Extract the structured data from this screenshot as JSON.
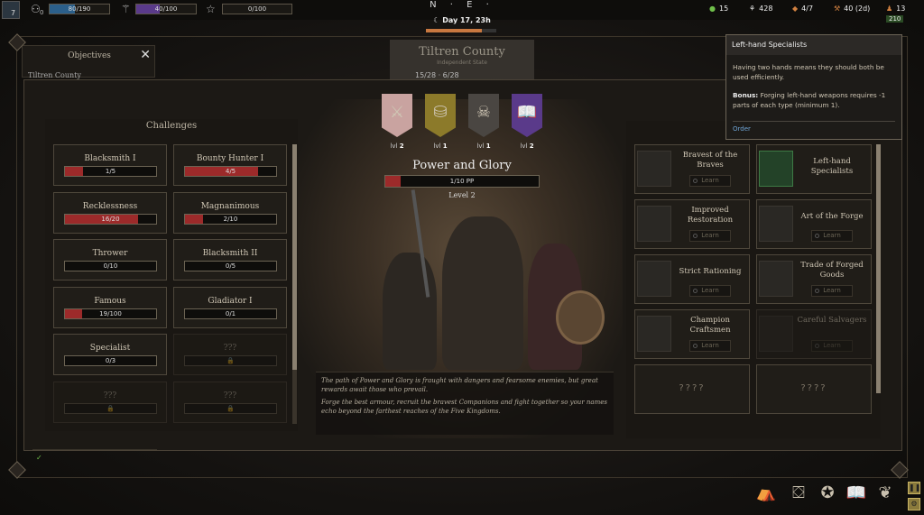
{
  "topbar": {
    "level": "7",
    "population": {
      "value": "80/190",
      "fill": 0.42
    },
    "mana": {
      "value": "40/100",
      "fill": 0.4
    },
    "fame": {
      "value": "0/100",
      "fill": 0
    },
    "small_count": "0",
    "compass": "N · E ·",
    "date": "Day 17, 23h",
    "resources": {
      "gold": "15",
      "food": "428",
      "materials": "4/7",
      "tools": "40 (2d)",
      "men": "13",
      "men_sub": "210"
    }
  },
  "objectives": {
    "title": "Objectives",
    "sub": "Tiltren County"
  },
  "county": {
    "name": "Tiltren County",
    "state": "Independent State",
    "counts": "15/28 · 6/28"
  },
  "challenges": {
    "title": "Challenges",
    "items": [
      {
        "name": "Blacksmith I",
        "progress": "1/5",
        "fill": 0.2
      },
      {
        "name": "Bounty Hunter I",
        "progress": "4/5",
        "fill": 0.8
      },
      {
        "name": "Recklessness",
        "progress": "16/20",
        "fill": 0.8
      },
      {
        "name": "Magnanimous",
        "progress": "2/10",
        "fill": 0.2
      },
      {
        "name": "Thrower",
        "progress": "0/10",
        "fill": 0
      },
      {
        "name": "Blacksmith II",
        "progress": "0/5",
        "fill": 0
      },
      {
        "name": "Famous",
        "progress": "19/100",
        "fill": 0.19
      },
      {
        "name": "Gladiator I",
        "progress": "0/1",
        "fill": 0
      },
      {
        "name": "Specialist",
        "progress": "0/3",
        "fill": 0
      },
      {
        "name": "???",
        "progress": "",
        "fill": 0,
        "locked": true
      },
      {
        "name": "???",
        "progress": "",
        "fill": 0,
        "locked": true
      },
      {
        "name": "???",
        "progress": "",
        "fill": 0,
        "locked": true
      }
    ]
  },
  "banners": [
    {
      "icon": "crossed-swords-icon",
      "glyph": "⚔",
      "color": "#c9a3a0",
      "level_prefix": "lvl",
      "level": "2"
    },
    {
      "icon": "coins-icon",
      "glyph": "⛁",
      "color": "#8c7a2a",
      "level_prefix": "lvl",
      "level": "1"
    },
    {
      "icon": "skull-icon",
      "glyph": "☠",
      "color": "#4a4642",
      "level_prefix": "lvl",
      "level": "1"
    },
    {
      "icon": "book-icon",
      "glyph": "📖",
      "color": "#5a3a8a",
      "level_prefix": "lvl",
      "level": "2"
    }
  ],
  "path": {
    "title": "Power and Glory",
    "pp": "1/10 PP",
    "pp_fill": 0.1,
    "level": "Level 2",
    "lore1": "The path of Power and Glory is fraught with dangers and fearsome enemies, but great rewards await those who prevail.",
    "lore2": "Forge the best armour, recruit the bravest Companions and fight together so your names echo beyond the farthest reaches of the Five Kingdoms."
  },
  "perks": {
    "learn_label": "Learn",
    "items": [
      {
        "name": "Bravest of the Braves",
        "highlight": false,
        "dim": false
      },
      {
        "name": "Left-hand Specialists",
        "highlight": true,
        "dim": false,
        "no_learn": true
      },
      {
        "name": "Improved Restoration",
        "highlight": false,
        "dim": false
      },
      {
        "name": "Art of the Forge",
        "highlight": false,
        "dim": false
      },
      {
        "name": "Strict Rationing",
        "highlight": false,
        "dim": false
      },
      {
        "name": "Trade of Forged Goods",
        "highlight": false,
        "dim": false
      },
      {
        "name": "Champion Craftsmen",
        "highlight": false,
        "dim": false
      },
      {
        "name": "Careful Salvagers",
        "highlight": false,
        "dim": true
      },
      {
        "name": "????",
        "empty": true
      },
      {
        "name": "????",
        "empty": true
      }
    ]
  },
  "tooltip": {
    "title": "Left-hand Specialists",
    "body": "Having two hands means they should both be used efficiently.",
    "bonus_label": "Bonus:",
    "bonus": "Forging left-hand weapons requires -1 parts of each type (minimum 1).",
    "order": "Order"
  },
  "colors": {
    "accent_red": "#9c2a2a",
    "gold": "#c8b464",
    "link": "#6fa5d6"
  }
}
